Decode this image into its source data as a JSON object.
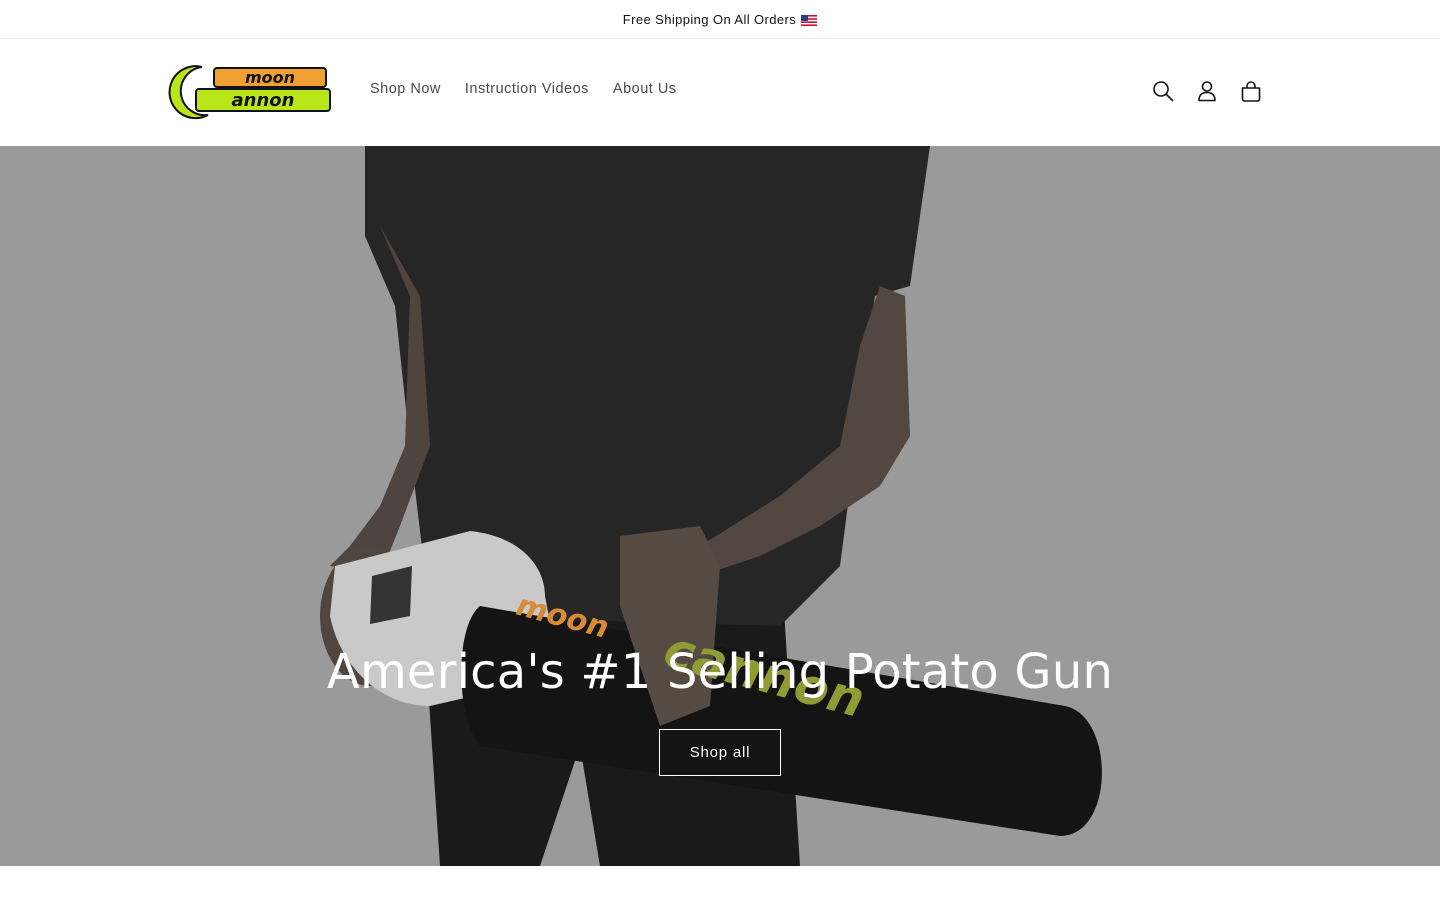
{
  "announcement": {
    "text": "Free Shipping On All Orders",
    "flag_icon": "us-flag-icon"
  },
  "header": {
    "logo_text_top": "moon",
    "logo_text_bottom": "annon",
    "logo_mark": "C",
    "nav": [
      {
        "label": "Shop Now"
      },
      {
        "label": "Instruction Videos"
      },
      {
        "label": "About Us"
      }
    ],
    "icons": [
      "search-icon",
      "account-icon",
      "cart-icon"
    ]
  },
  "hero": {
    "heading": "America's #1 Selling Potato Gun",
    "button_label": "Shop all",
    "product_text_moon": "moon",
    "product_text_cannon": "cannon"
  },
  "colors": {
    "brand_green": "#b8e619",
    "brand_orange": "#f0a030",
    "hero_background": "#9b9b9b",
    "text_dark": "#121212"
  }
}
